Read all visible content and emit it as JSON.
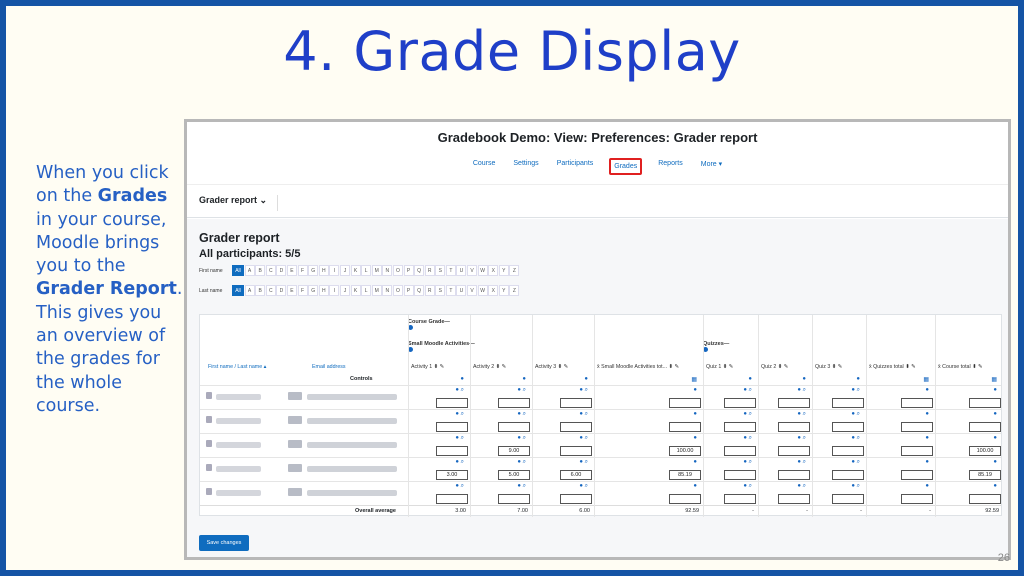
{
  "slide": {
    "title": "4. Grade Display",
    "page_number": "26",
    "side_text": {
      "t1": "When you click on the ",
      "b1": "Grades",
      "t2": " in your course, Moodle brings you to the ",
      "b2": "Grader Report",
      "t3": ". This gives you an overview of the grades for the whole course."
    }
  },
  "screenshot": {
    "heading": "Gradebook Demo: View: Preferences: Grader report",
    "nav": [
      "Course",
      "Settings",
      "Participants",
      "Grades",
      "Reports",
      "More ▾"
    ],
    "selector": "Grader report ⌄",
    "page_title": "Grader report",
    "participants": "All participants: 5/5",
    "first_name_label": "First name",
    "last_name_label": "Last name",
    "letters": [
      "All",
      "A",
      "B",
      "C",
      "D",
      "E",
      "F",
      "G",
      "H",
      "I",
      "J",
      "K",
      "L",
      "M",
      "N",
      "O",
      "P",
      "Q",
      "R",
      "S",
      "T",
      "U",
      "V",
      "W",
      "X",
      "Y",
      "Z"
    ],
    "course_grade_label": "Course Grade—",
    "small_moodle_label": "Small Moodle Activities—",
    "quizzes_label": "Quizzes—",
    "col_first_last": "First name / Last name ▴",
    "col_email": "Email address",
    "columns": [
      "Activity 1 ⬍ ✎",
      "Activity 2 ⬍ ✎",
      "Activity 3 ⬍ ✎",
      "x̄ Small Moodle Activities tot... ⬍ ✎",
      "Quiz 1 ⬍ ✎",
      "Quiz 2 ⬍ ✎",
      "Quiz 3 ⬍ ✎",
      "x̄ Quizzes total ⬍ ✎",
      "x̄ Course total ⬍ ✎"
    ],
    "controls_label": "Controls",
    "rows": [
      [
        "",
        "",
        "",
        "",
        "",
        "",
        "",
        "",
        ""
      ],
      [
        "",
        "",
        "",
        "",
        "",
        "",
        "",
        "",
        ""
      ],
      [
        "",
        "9.00",
        "",
        "100.00",
        "",
        "",
        "",
        "",
        "100.00"
      ],
      [
        "3.00",
        "5.00",
        "6.00",
        "85.19",
        "",
        "",
        "",
        "",
        "85.19"
      ],
      [
        "",
        "",
        "",
        "",
        "",
        "",
        "",
        "",
        ""
      ]
    ],
    "overall_label": "Overall average",
    "overall": [
      "3.00",
      "7.00",
      "6.00",
      "92.59",
      "-",
      "-",
      "-",
      "-",
      "92.59"
    ],
    "save_label": "Save changes"
  },
  "colors": {
    "frame": "#1554a5",
    "title": "#1f3fc8",
    "body_text": "#2660c4",
    "moodle_blue": "#0f6cbf",
    "highlight": "#e02020"
  }
}
